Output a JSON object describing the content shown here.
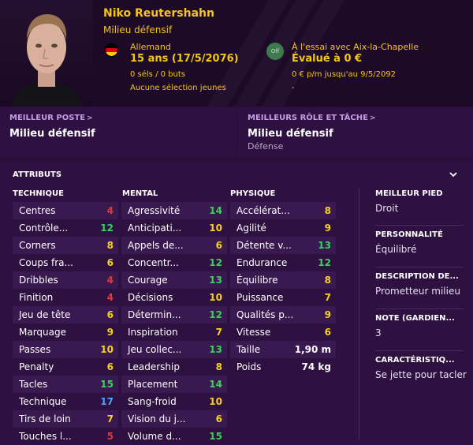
{
  "player": {
    "name": "Niko Reutershahn",
    "position": "Milieu défensif",
    "nationality": "Allemand",
    "age": "15 ans (17/5/2076)",
    "caps": "0 séls / 0 buts",
    "youth": "Aucune sélection jeunes",
    "off_badge": "Off",
    "trial": "À l'essai avec Aix-la-Chapelle",
    "value": "Évalué à 0 €",
    "contract": "0 € p/m jusqu'au 9/5/2092",
    "dash": "-",
    "flag_colors": [
      "#000000",
      "#dd0000",
      "#ffce00"
    ]
  },
  "best_position": {
    "title": "MEILLEUR POSTE",
    "chevron": ">",
    "value": "Milieu défensif"
  },
  "best_role": {
    "title": "MEILLEURS RÔLE ET TÂCHE",
    "chevron": ">",
    "value": "Milieu défensif",
    "sub": "Défense"
  },
  "attributes": {
    "title": "ATTRIBUTS",
    "technique": {
      "title": "TECHNIQUE",
      "items": [
        {
          "name": "Centres",
          "value": "4",
          "color": "red"
        },
        {
          "name": "Contrôle...",
          "value": "12",
          "color": "green"
        },
        {
          "name": "Corners",
          "value": "8",
          "color": "yellow"
        },
        {
          "name": "Coups fra...",
          "value": "6",
          "color": "yellow"
        },
        {
          "name": "Dribbles",
          "value": "4",
          "color": "red"
        },
        {
          "name": "Finition",
          "value": "4",
          "color": "red"
        },
        {
          "name": "Jeu de tête",
          "value": "6",
          "color": "yellow"
        },
        {
          "name": "Marquage",
          "value": "9",
          "color": "yellow"
        },
        {
          "name": "Passes",
          "value": "10",
          "color": "yellow"
        },
        {
          "name": "Penalty",
          "value": "6",
          "color": "yellow"
        },
        {
          "name": "Tacles",
          "value": "15",
          "color": "green"
        },
        {
          "name": "Technique",
          "value": "17",
          "color": "blue"
        },
        {
          "name": "Tirs de loin",
          "value": "7",
          "color": "yellow"
        },
        {
          "name": "Touches l...",
          "value": "5",
          "color": "red"
        }
      ]
    },
    "mental": {
      "title": "MENTAL",
      "items": [
        {
          "name": "Agressivité",
          "value": "14",
          "color": "green"
        },
        {
          "name": "Anticipati...",
          "value": "10",
          "color": "yellow"
        },
        {
          "name": "Appels de...",
          "value": "6",
          "color": "yellow"
        },
        {
          "name": "Concentr...",
          "value": "12",
          "color": "green"
        },
        {
          "name": "Courage",
          "value": "13",
          "color": "green"
        },
        {
          "name": "Décisions",
          "value": "10",
          "color": "yellow"
        },
        {
          "name": "Détermin...",
          "value": "12",
          "color": "green"
        },
        {
          "name": "Inspiration",
          "value": "7",
          "color": "yellow"
        },
        {
          "name": "Jeu collec...",
          "value": "13",
          "color": "green"
        },
        {
          "name": "Leadership",
          "value": "8",
          "color": "yellow"
        },
        {
          "name": "Placement",
          "value": "14",
          "color": "green"
        },
        {
          "name": "Sang-froid",
          "value": "10",
          "color": "yellow"
        },
        {
          "name": "Vision du j...",
          "value": "6",
          "color": "yellow"
        },
        {
          "name": "Volume d...",
          "value": "15",
          "color": "green"
        }
      ]
    },
    "physique": {
      "title": "PHYSIQUE",
      "items": [
        {
          "name": "Accélérat...",
          "value": "8",
          "color": "yellow"
        },
        {
          "name": "Agilité",
          "value": "9",
          "color": "yellow"
        },
        {
          "name": "Détente v...",
          "value": "13",
          "color": "green"
        },
        {
          "name": "Endurance",
          "value": "12",
          "color": "green"
        },
        {
          "name": "Équilibre",
          "value": "8",
          "color": "yellow"
        },
        {
          "name": "Puissance",
          "value": "7",
          "color": "yellow"
        },
        {
          "name": "Qualités p...",
          "value": "9",
          "color": "yellow"
        },
        {
          "name": "Vitesse",
          "value": "6",
          "color": "yellow"
        },
        {
          "name": "Taille",
          "value": "1,90 m",
          "color": "white"
        },
        {
          "name": "Poids",
          "value": "74 kg",
          "color": "white"
        }
      ]
    }
  },
  "info": {
    "best_foot": {
      "title": "MEILLEUR PIED",
      "value": "Droit"
    },
    "personality": {
      "title": "PERSONNALITÉ",
      "value": "Équilibré"
    },
    "description": {
      "title": "DESCRIPTION DE...",
      "value": "Prometteur milieu"
    },
    "note": {
      "title": "NOTE (GARDIEN...",
      "value": "3"
    },
    "traits": {
      "title": "CARACTÉRISTIQ...",
      "value": "Se jette pour tacler"
    }
  },
  "colors": {
    "background": "#2b0f3a",
    "header": "#1c0a26",
    "accent": "#f5c518",
    "link": "#c89be8",
    "red": "#e03a3a",
    "yellow": "#f5d21e",
    "green": "#3ad15c",
    "blue": "#4aa2ff"
  }
}
